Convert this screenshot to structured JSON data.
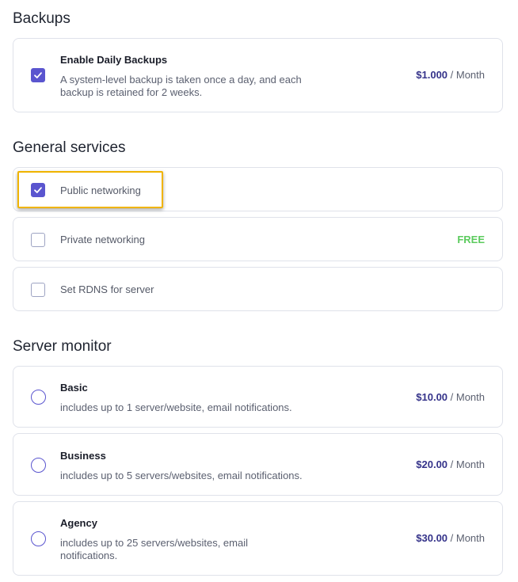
{
  "backups": {
    "title": "Backups",
    "item": {
      "title": "Enable Daily Backups",
      "desc_line1": "A system-level backup is taken once a day, and each",
      "desc_line2": "backup is retained for 2 weeks.",
      "price": "$1.000",
      "period": " / Month",
      "checked": true
    }
  },
  "general": {
    "title": "General services",
    "items": [
      {
        "label": "Public networking",
        "checked": true
      },
      {
        "label": "Private networking",
        "badge": "FREE",
        "checked": false
      },
      {
        "label": "Set RDNS for server",
        "checked": false
      }
    ]
  },
  "monitor": {
    "title": "Server monitor",
    "items": [
      {
        "title": "Basic",
        "desc_line1": "includes up to 1 server/website, email notifications.",
        "price": "$10.00",
        "period": " / Month"
      },
      {
        "title": "Business",
        "desc_line1": "includes up to 5 servers/websites, email notifications.",
        "price": "$20.00",
        "period": " / Month"
      },
      {
        "title": "Agency",
        "desc_line1": "includes up to 25 servers/websites, email",
        "desc_line2": "notifications.",
        "price": "$30.00",
        "period": " / Month"
      }
    ]
  },
  "colors": {
    "accent": "#5a55cf",
    "price": "#35338a",
    "free": "#5ccb5e",
    "highlight": "#f0b400"
  }
}
